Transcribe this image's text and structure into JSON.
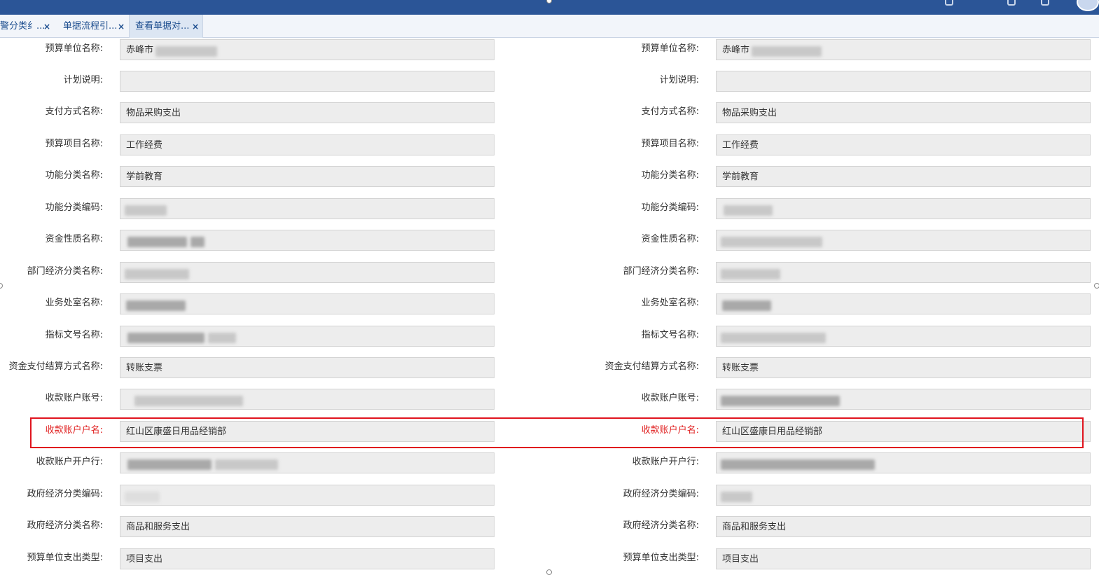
{
  "tabs": [
    {
      "label": "警分类纟...",
      "close": "×"
    },
    {
      "label": "单据流程引...",
      "close": "×"
    },
    {
      "label": "查看单据对...",
      "close": "×"
    }
  ],
  "left_fields": [
    {
      "label": "预算单位名称:",
      "value": "赤峰市"
    },
    {
      "label": "计划说明:",
      "value": ""
    },
    {
      "label": "支付方式名称:",
      "value": "物品采购支出"
    },
    {
      "label": "预算项目名称:",
      "value": "工作经费"
    },
    {
      "label": "功能分类名称:",
      "value": "学前教育"
    },
    {
      "label": "功能分类编码:",
      "value": ""
    },
    {
      "label": "资金性质名称:",
      "value": ""
    },
    {
      "label": "部门经济分类名称:",
      "value": ""
    },
    {
      "label": "业务处室名称:",
      "value": ""
    },
    {
      "label": "指标文号名称:",
      "value": ""
    },
    {
      "label": "资金支付结算方式名称:",
      "value": "转账支票"
    },
    {
      "label": "收款账户账号:",
      "value": ""
    },
    {
      "label": "收款账户户名:",
      "value": "红山区康盛日用品经销部"
    },
    {
      "label": "收款账户开户行:",
      "value": ""
    },
    {
      "label": "政府经济分类编码:",
      "value": ""
    },
    {
      "label": "政府经济分类名称:",
      "value": "商品和服务支出"
    },
    {
      "label": "预算单位支出类型:",
      "value": "项目支出"
    }
  ],
  "right_fields": [
    {
      "label": "预算单位名称:",
      "value": "赤峰市"
    },
    {
      "label": "计划说明:",
      "value": ""
    },
    {
      "label": "支付方式名称:",
      "value": "物品采购支出"
    },
    {
      "label": "预算项目名称:",
      "value": "工作经费"
    },
    {
      "label": "功能分类名称:",
      "value": "学前教育"
    },
    {
      "label": "功能分类编码:",
      "value": ""
    },
    {
      "label": "资金性质名称:",
      "value": ""
    },
    {
      "label": "部门经济分类名称:",
      "value": ""
    },
    {
      "label": "业务处室名称:",
      "value": ""
    },
    {
      "label": "指标文号名称:",
      "value": ""
    },
    {
      "label": "资金支付结算方式名称:",
      "value": "转账支票"
    },
    {
      "label": "收款账户账号:",
      "value": ""
    },
    {
      "label": "收款账户户名:",
      "value": "红山区盛康日用品经销部"
    },
    {
      "label": "收款账户开户行:",
      "value": ""
    },
    {
      "label": "政府经济分类编码:",
      "value": ""
    },
    {
      "label": "政府经济分类名称:",
      "value": "商品和服务支出"
    },
    {
      "label": "预算单位支出类型:",
      "value": "项目支出"
    }
  ],
  "colors": {
    "topbar": "#2b5597",
    "highlight": "#e0141e",
    "field_bg": "#ededed"
  }
}
